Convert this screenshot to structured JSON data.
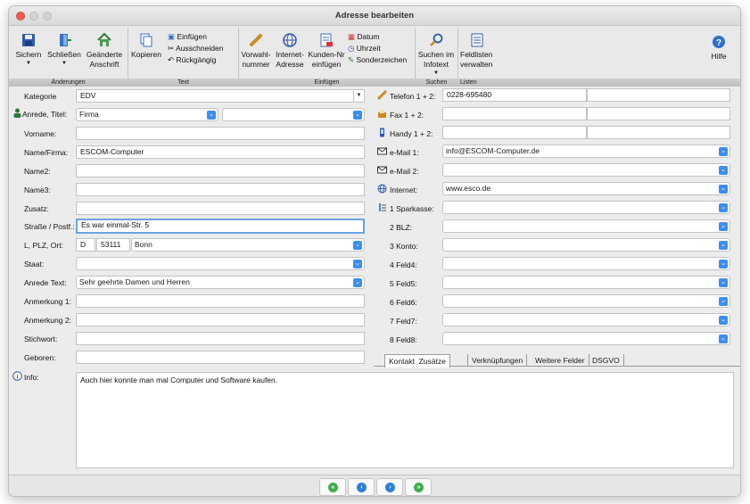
{
  "window": {
    "title": "Adresse bearbeiten"
  },
  "toolbar": {
    "save_label": "Sichern",
    "close_label": "Schließen",
    "changed_address_label": "Geänderte Anschrift",
    "copy_label": "Kopieren",
    "paste_label": "Einfügen",
    "cut_label": "Ausschneiden",
    "undo_label": "Rückgängig",
    "area_code_label": "Vorwahl-nummer",
    "internet_address_label": "Internet-Adresse",
    "customer_no_label": "Kunden-Nr einfügen",
    "date_label": "Datum",
    "time_label": "Uhrzeit",
    "special_chars_label": "Sonderzeichen",
    "search_infotext_label": "Suchen im Infotext",
    "field_lists_label": "Feldlisten verwalten",
    "help_label": "Hilfe",
    "groups": {
      "changes": "Änderungen",
      "text": "Text",
      "insert": "Einfügen",
      "search": "Suchen",
      "lists": "Listen"
    }
  },
  "left_form": {
    "kategorie": {
      "label": "Kategorie",
      "value": "EDV"
    },
    "anrede_titel": {
      "label": "Anrede, Titel:",
      "value": "Firma",
      "title_value": ""
    },
    "vorname": {
      "label": "Vorname:",
      "value": ""
    },
    "name_firma": {
      "label": "Name/Firma:",
      "value": "ESCOM-Computer"
    },
    "name2": {
      "label": "Name2:",
      "value": ""
    },
    "name3": {
      "label": "Name3:",
      "value": ""
    },
    "zusatz": {
      "label": "Zusatz:",
      "value": ""
    },
    "strasse": {
      "label": "Straße / Postf.:",
      "value": "Es war einmal-Str. 5"
    },
    "plz_ort": {
      "label": "L, PLZ, Ort:",
      "land": "D",
      "plz": "53111",
      "ort": "Bonn"
    },
    "staat": {
      "label": "Staat:",
      "value": ""
    },
    "anrede_text": {
      "label": "Anrede Text:",
      "value": "Sehr geehrte Damen und Herren"
    },
    "anmerkung1": {
      "label": "Anmerkung 1:",
      "value": ""
    },
    "anmerkung2": {
      "label": "Anmerkung 2:",
      "value": ""
    },
    "stichwort": {
      "label": "Stichwort:",
      "value": ""
    },
    "geboren": {
      "label": "Geboren:",
      "value": ""
    },
    "info": {
      "label": "Info:",
      "value": "Auch hier konnte man mal Computer und Software kaufen."
    }
  },
  "right_form": {
    "telefon": {
      "label": "Telefon 1 + 2:",
      "value1": "0228-695480",
      "value2": ""
    },
    "fax": {
      "label": "Fax 1 + 2:",
      "value1": "",
      "value2": ""
    },
    "handy": {
      "label": "Handy 1 + 2:",
      "value1": "",
      "value2": ""
    },
    "email1": {
      "label": "e-Mail 1:",
      "value": "info@ESCOM-Computer.de"
    },
    "email2": {
      "label": "e-Mail 2:",
      "value": ""
    },
    "internet": {
      "label": "Internet:",
      "value": "www.esco.de"
    },
    "sparkasse": {
      "label": "1 Sparkasse:",
      "value": ""
    },
    "blz": {
      "label": "2 BLZ:",
      "value": ""
    },
    "konto": {
      "label": "3 Konto:",
      "value": ""
    },
    "feld4": {
      "label": "4 Feld4:",
      "value": ""
    },
    "feld5": {
      "label": "5 Feld5:",
      "value": ""
    },
    "feld6": {
      "label": "6 Feld6:",
      "value": ""
    },
    "feld7": {
      "label": "7 Feld7:",
      "value": ""
    },
    "feld8": {
      "label": "8 Feld8:",
      "value": ""
    }
  },
  "tabs": [
    "Kontakt",
    "Zusätze",
    "Verknüpfungen",
    "Weitere Felder",
    "DSGVO"
  ],
  "colors": {
    "accent": "#3b8fef",
    "nav_green": "#3fae49",
    "nav_blue": "#2f7fd8",
    "close": "#ec5f57"
  }
}
